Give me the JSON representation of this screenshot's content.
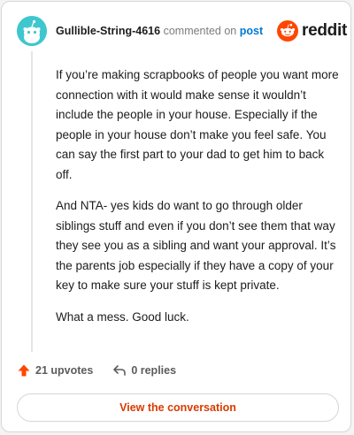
{
  "header": {
    "username": "Gullible-String-4616",
    "commented_on": "commented on",
    "post_link": "post",
    "brand": "reddit"
  },
  "comment": {
    "paragraphs": [
      "If you’re making scrapbooks of people you want more connection with it would make sense it wouldn’t include the people in your house. Especially if the people in your house don’t make you feel safe. You can say the first part to your dad to get him to back off.",
      "And NTA- yes kids do want to go through older siblings stuff and even if you don’t see them that way they see you as a sibling and want your approval. It’s the parents job especially if they have a copy of your key to make sure your stuff is kept private.",
      "What a mess. Good luck."
    ]
  },
  "actions": {
    "upvotes": "21 upvotes",
    "replies": "0 replies"
  },
  "view_conversation": "View the conversation",
  "colors": {
    "brand_orange": "#ff4500",
    "link_blue": "#0079d3",
    "button_text": "#d93a00",
    "avatar_bg": "#3fc7d0"
  },
  "icons": {
    "avatar": "snoo-avatar-icon",
    "logo": "reddit-logo-icon",
    "upvote": "upvote-arrow-icon",
    "reply": "reply-arrow-icon"
  }
}
